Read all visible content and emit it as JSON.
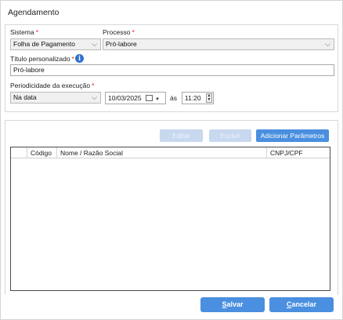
{
  "window": {
    "title": "Agendamento"
  },
  "form": {
    "sistema": {
      "label": "Sistema",
      "required_mark": "*",
      "value": "Folha de Pagamento"
    },
    "processo": {
      "label": "Processo",
      "required_mark": "*",
      "value": "Pró-labore"
    },
    "titulo": {
      "label": "Título personalizado",
      "required_mark": "*",
      "value": "Pró-labore",
      "info_icon": "info-icon"
    },
    "periodicidade": {
      "label": "Periodicidade da execução",
      "required_mark": "*",
      "value": "Na data"
    },
    "date": {
      "value": "10/03/2025"
    },
    "as_label": "às",
    "time": {
      "value": "11:20"
    }
  },
  "parameters": {
    "buttons": {
      "edit": "Editar",
      "delete": "Excluir",
      "add": "Adicionar Parâmetros"
    },
    "columns": [
      "Código",
      "Nome / Razão Social",
      "CNPJ/CPF"
    ],
    "rows": []
  },
  "footer": {
    "save_first": "S",
    "save_rest": "alvar",
    "cancel_first": "C",
    "cancel_rest": "ancelar"
  },
  "colors": {
    "accent": "#4a8fe0",
    "required": "#e0262b",
    "disabled": "#c7d8ef"
  }
}
